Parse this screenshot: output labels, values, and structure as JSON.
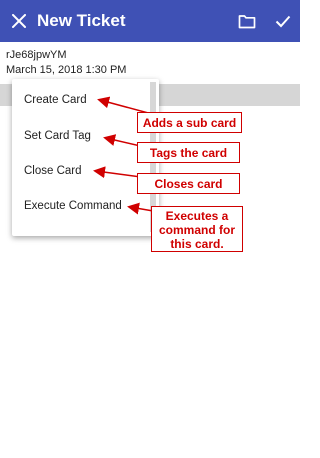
{
  "app_bar": {
    "title": "New Ticket",
    "close_icon": "close-icon",
    "folder_icon": "folder-icon",
    "check_icon": "check-icon",
    "color": "#3f51b5"
  },
  "ticket": {
    "id": "rJe68jpwYM",
    "date": "March 15, 2018 1:30 PM"
  },
  "menu": {
    "items": [
      {
        "label": "Create Card"
      },
      {
        "label": "Set Card Tag"
      },
      {
        "label": "Close Card"
      },
      {
        "label": "Execute Command"
      }
    ]
  },
  "annotations": [
    {
      "text": "Adds a sub card"
    },
    {
      "text": "Tags the card"
    },
    {
      "text": "Closes card"
    },
    {
      "text": "Executes a\ncommand for\nthis card."
    }
  ],
  "annotation_color": "#d00000"
}
